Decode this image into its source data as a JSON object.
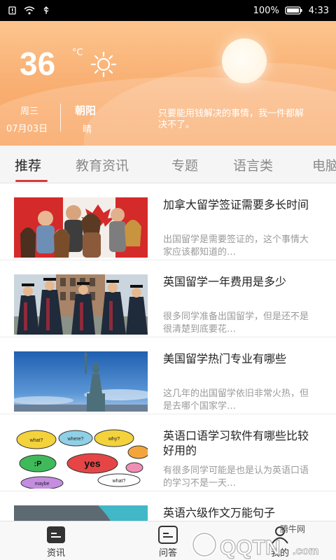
{
  "status_bar": {
    "battery": "100%",
    "time": "4:33"
  },
  "weather": {
    "temperature": "36",
    "unit": "°C",
    "day": "周三",
    "date": "07月03日",
    "city": "朝阳",
    "condition": "晴",
    "quote": "只要能用钱解决的事情，我一件都解决不了。"
  },
  "tabs": [
    {
      "label": "推荐",
      "active": true
    },
    {
      "label": "教育资讯",
      "active": false
    },
    {
      "label": "专题",
      "active": false
    },
    {
      "label": "语言类",
      "active": false
    },
    {
      "label": "电脑",
      "active": false
    }
  ],
  "articles": [
    {
      "title": "加拿大留学签证需要多长时间",
      "desc": "出国留学是需要签证的，这个事情大家应该都知道的…",
      "image": "canada-flag-students"
    },
    {
      "title": "英国留学一年费用是多少",
      "desc": "很多同学准备出国留学，但是还不是很清楚到底要花…",
      "image": "graduates"
    },
    {
      "title": "美国留学热门专业有哪些",
      "desc": "这几年的出国留学依旧非常火热，但是去哪个国家学…",
      "image": "statue-of-liberty"
    },
    {
      "title": "英语口语学习软件有哪些比较好用的",
      "desc": "有很多同学可能是也是认为英语口语的学习不是一天…",
      "image": "speech-bubbles"
    },
    {
      "title": "英语六级作文万能句子",
      "desc": "",
      "image": "partial"
    }
  ],
  "bottom_nav": [
    {
      "label": "资讯",
      "icon": "news-icon"
    },
    {
      "label": "问答",
      "icon": "qa-icon"
    },
    {
      "label": "我的",
      "icon": "profile-icon"
    }
  ],
  "bubble_words": {
    "what": "what?",
    "where": "where?",
    "why": "why?",
    "yes": "yes",
    "p": ":P",
    "maybe": "maybe"
  },
  "watermark": {
    "site": "腾牛网",
    "brand": "QQTN",
    "domain": ".com"
  },
  "colors": {
    "accent": "#d23c3c",
    "header": "#f9b175"
  }
}
